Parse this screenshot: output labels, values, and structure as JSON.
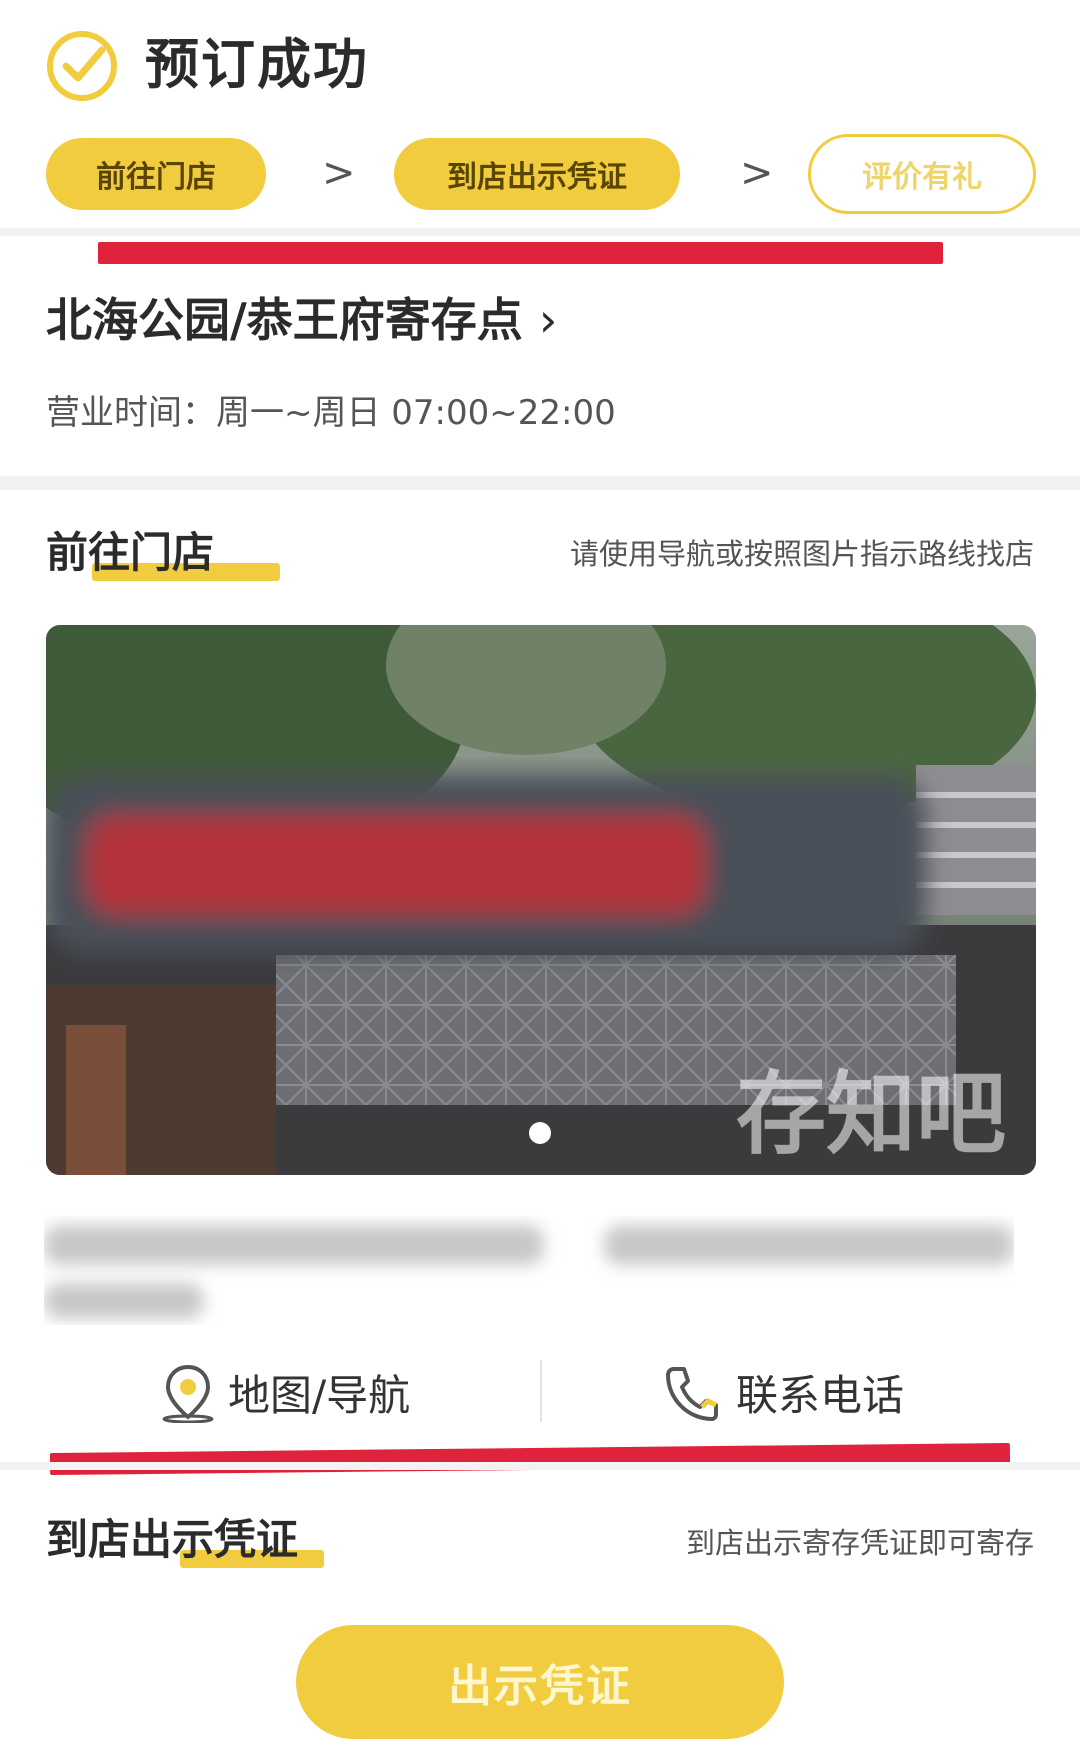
{
  "header": {
    "title": "预订成功",
    "icon": "check-circle-icon"
  },
  "steps": [
    {
      "label": "前往门店",
      "style": "filled"
    },
    {
      "label": "到店出示凭证",
      "style": "filled"
    },
    {
      "label": "评价有礼",
      "style": "outline"
    }
  ],
  "store": {
    "name": "北海公园/恭王府寄存点",
    "chevron": "›",
    "hours": "营业时间：周一~周日 07:00~22:00"
  },
  "go_store": {
    "title": "前往门店",
    "hint": "请使用导航或按照图片指示路线找店",
    "photo_watermark": "存知吧"
  },
  "actions": {
    "map": "地图/导航",
    "phone": "联系电话"
  },
  "voucher": {
    "title": "到店出示凭证",
    "hint": "到店出示寄存凭证即可寄存",
    "button": "出示凭证"
  },
  "colors": {
    "accent": "#f1cc3e",
    "annotation_red": "#e0233c"
  }
}
